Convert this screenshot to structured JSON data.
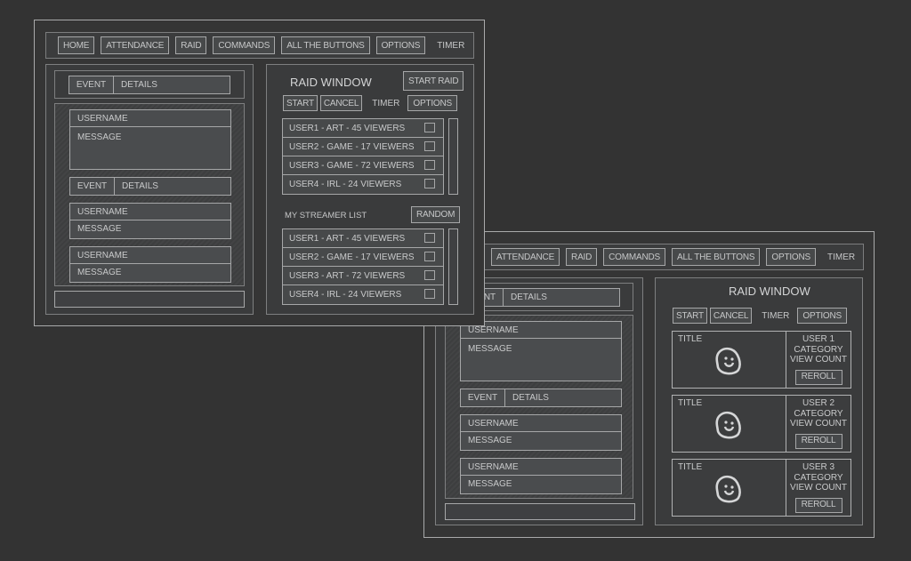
{
  "nav": {
    "items": [
      "HOME",
      "ATTENDANCE",
      "RAID",
      "COMMANDS",
      "ALL THE BUTTONS",
      "OPTIONS"
    ],
    "timer_label": "TIMER"
  },
  "chat": {
    "event_label": "EVENT",
    "details_label": "DETAILS",
    "username_label": "USERNAME",
    "message_label": "MESSAGE",
    "input_value": ""
  },
  "raid_v1": {
    "title": "RAID WINDOW",
    "start_raid": "START RAID",
    "start": "START",
    "cancel": "CANCEL",
    "timer": "TIMER",
    "options": "OPTIONS",
    "raid_list": [
      {
        "label": "USER1 - ART - 45 VIEWERS",
        "checked": false
      },
      {
        "label": "USER2 - GAME - 17 VIEWERS",
        "checked": false
      },
      {
        "label": "USER3 -  GAME - 72 VIEWERS",
        "checked": false
      },
      {
        "label": "USER4 - IRL - 24 VIEWERS",
        "checked": false
      }
    ],
    "streamer_list_title": "MY STREAMER LIST",
    "random": "RANDOM",
    "streamer_list": [
      {
        "label": "USER1 - ART - 45 VIEWERS",
        "checked": false
      },
      {
        "label": "USER2 - GAME - 17 VIEWERS",
        "checked": false
      },
      {
        "label": "USER3 -  ART - 72 VIEWERS",
        "checked": false
      },
      {
        "label": "USER4 - IRL - 24 VIEWERS",
        "checked": false
      }
    ]
  },
  "raid_v2": {
    "title": "RAID WINDOW",
    "start": "START",
    "cancel": "CANCEL",
    "timer": "TIMER",
    "options": "OPTIONS",
    "cards": [
      {
        "title": "TITLE",
        "user": "USER 1",
        "category": "CATEGORY",
        "view_count": "VIEW COUNT",
        "reroll": "REROLL",
        "icon": "smiley-icon"
      },
      {
        "title": "TITLE",
        "user": "USER 2",
        "category": "CATEGORY",
        "view_count": "VIEW COUNT",
        "reroll": "REROLL",
        "icon": "smiley-icon"
      },
      {
        "title": "TITLE",
        "user": "USER 3",
        "category": "CATEGORY",
        "view_count": "VIEW COUNT",
        "reroll": "REROLL",
        "icon": "smiley-icon"
      }
    ]
  },
  "colors": {
    "background": "#333333",
    "frame_border": "#a9aaab",
    "box_fill": "#4a4c4e",
    "text": "#c9cacb"
  }
}
